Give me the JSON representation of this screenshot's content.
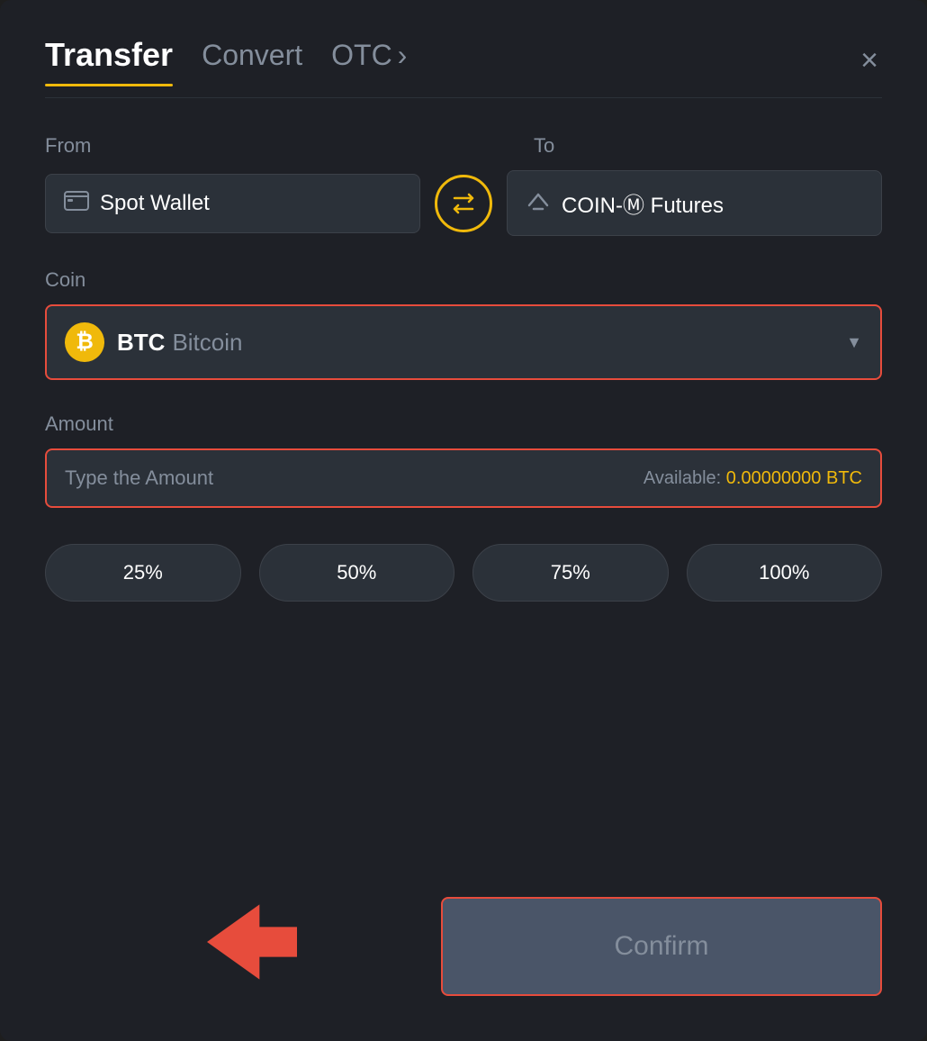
{
  "header": {
    "tab_transfer": "Transfer",
    "tab_convert": "Convert",
    "tab_otc": "OTC",
    "tab_otc_arrow": "›",
    "close_icon": "×"
  },
  "from_to": {
    "from_label": "From",
    "to_label": "To",
    "from_wallet": "Spot Wallet",
    "to_wallet": "COIN-Ⓜ Futures",
    "swap_icon": "⇄"
  },
  "coin": {
    "label": "Coin",
    "symbol": "BTC",
    "name": "Bitcoin",
    "dropdown_icon": "▼"
  },
  "amount": {
    "label": "Amount",
    "placeholder": "Type the Amount",
    "available_label": "Available:",
    "available_value": "0.00000000 BTC"
  },
  "percent_buttons": [
    "25%",
    "50%",
    "75%",
    "100%"
  ],
  "confirm_button": "Confirm"
}
